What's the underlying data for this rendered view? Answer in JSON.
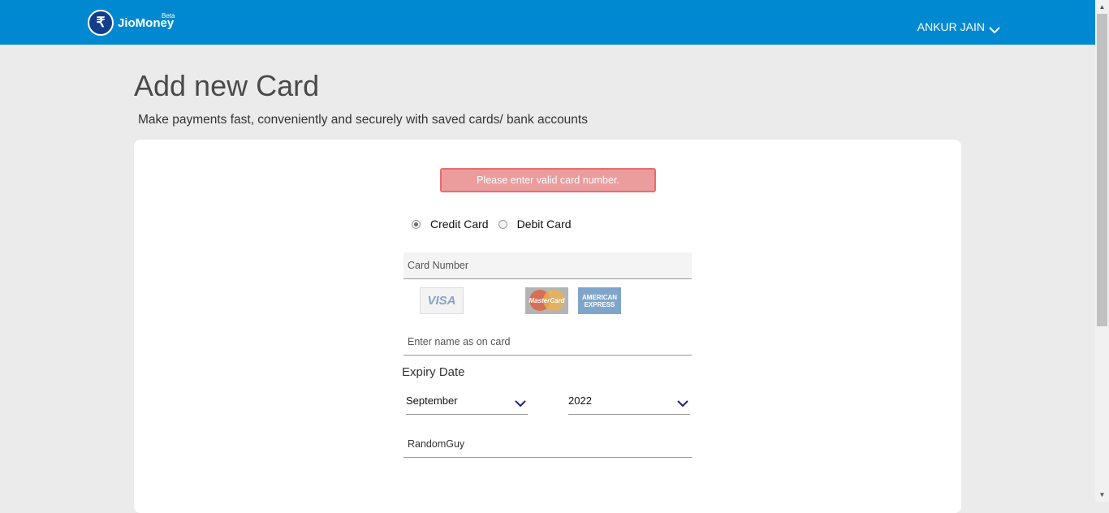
{
  "header": {
    "brand": "JioMoney",
    "beta": "Beta",
    "logo_symbol": "₹",
    "user_name": "ANKUR JAIN",
    "bg_color": "#0089d0"
  },
  "page": {
    "title": "Add new Card",
    "subtitle": "Make payments fast, conveniently and securely with saved cards/ bank accounts"
  },
  "form": {
    "error_message": "Please enter valid card number.",
    "card_types": [
      {
        "label": "Credit Card",
        "checked": true
      },
      {
        "label": "Debit Card",
        "checked": false
      }
    ],
    "card_number": {
      "placeholder": "Card Number",
      "value": ""
    },
    "card_brands": {
      "visa": "VISA",
      "mastercard": "MasterCard",
      "amex_line1": "AMERICAN",
      "amex_line2": "EXPRESS"
    },
    "name_on_card": {
      "placeholder": "Enter name as on card",
      "value": ""
    },
    "expiry_label": "Expiry Date",
    "expiry_month": {
      "selected": "September"
    },
    "expiry_year": {
      "selected": "2022"
    },
    "nickname": {
      "value": "RandomGuy"
    }
  },
  "colors": {
    "error_bg": "#eb9c9c",
    "error_border": "#e86c70",
    "chevron": "#1a237e"
  }
}
